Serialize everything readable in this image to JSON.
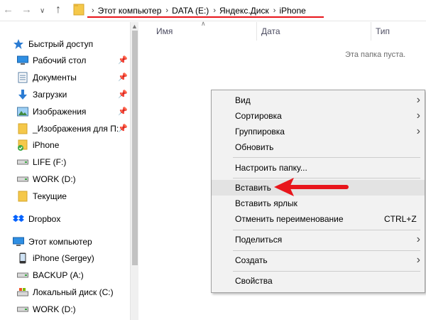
{
  "addressbar": {
    "crumbs": [
      "Этот компьютер",
      "DATA (E:)",
      "Яндекс.Диск",
      "iPhone"
    ]
  },
  "sidebar": {
    "quick_access": "Быстрый доступ",
    "quick_items": [
      {
        "label": "Рабочий стол",
        "icon": "desktop-icon",
        "pinned": true
      },
      {
        "label": "Документы",
        "icon": "documents-icon",
        "pinned": true
      },
      {
        "label": "Загрузки",
        "icon": "downloads-icon",
        "pinned": true
      },
      {
        "label": "Изображения",
        "icon": "pictures-icon",
        "pinned": true
      },
      {
        "label": "_Изображения для П:",
        "icon": "folder-icon",
        "pinned": true
      },
      {
        "label": "iPhone",
        "icon": "synced-folder-icon",
        "pinned": false
      },
      {
        "label": "LIFE (F:)",
        "icon": "drive-icon",
        "pinned": false
      },
      {
        "label": "WORK (D:)",
        "icon": "drive-icon",
        "pinned": false
      },
      {
        "label": "Текущие",
        "icon": "folder-icon",
        "pinned": false
      }
    ],
    "dropbox": "Dropbox",
    "this_pc": "Этот компьютер",
    "pc_items": [
      {
        "label": "iPhone (Sergey)",
        "icon": "phone-icon"
      },
      {
        "label": "BACKUP (A:)",
        "icon": "drive-icon"
      },
      {
        "label": "Локальный диск (C:)",
        "icon": "system-drive-icon"
      },
      {
        "label": "WORK (D:)",
        "icon": "drive-icon"
      }
    ]
  },
  "columns": {
    "name": "Имя",
    "date": "Дата",
    "type": "Тип"
  },
  "empty_message": "Эта папка пуста.",
  "context_menu": {
    "view": "Вид",
    "sort": "Сортировка",
    "group": "Группировка",
    "refresh": "Обновить",
    "customize": "Настроить папку...",
    "paste": "Вставить",
    "paste_shortcut": "Вставить ярлык",
    "undo_rename": "Отменить переименование",
    "undo_shortcut": "CTRL+Z",
    "share": "Поделиться",
    "create": "Создать",
    "properties": "Свойства"
  },
  "colors": {
    "annotation": "#e8151b",
    "folder": "#f5c84a",
    "accent": "#1a73c8"
  }
}
